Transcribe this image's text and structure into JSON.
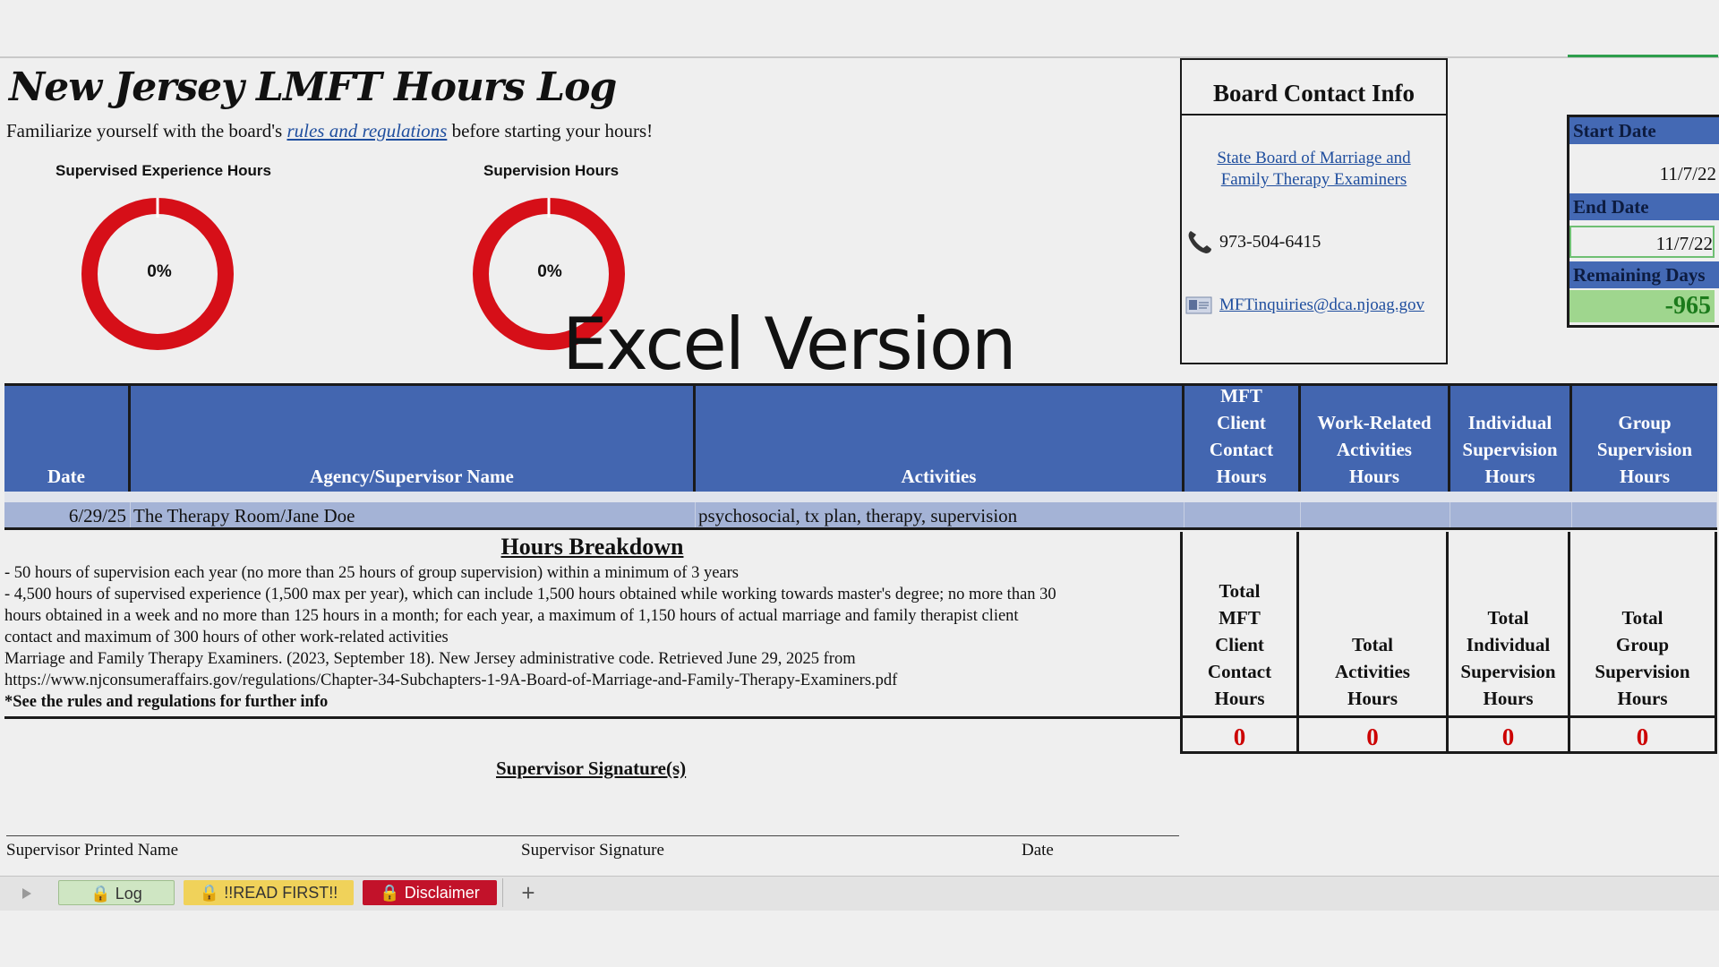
{
  "title": "New Jersey LMFT Hours Log",
  "subtitle": {
    "before": "Familiarize yourself with the board's ",
    "link": "rules and regulations",
    "after": " before starting your hours!"
  },
  "gauges": [
    {
      "label": "Supervised Experience Hours",
      "percent_text": "0%",
      "progress": 0
    },
    {
      "label": "Supervision Hours",
      "percent_text": "0%",
      "progress": 0
    }
  ],
  "watermark": "Excel Version",
  "contact": {
    "heading": "Board Contact Info",
    "board_link_line1": "State Board of Marriage and",
    "board_link_line2": "Family Therapy Examiners",
    "phone": "973-504-6415",
    "email": "MFTinquiries@dca.njoag.gov",
    "phone_icon": "phone-icon",
    "email_icon": "email-icon"
  },
  "dates": {
    "start_label": "Start Date",
    "start_value": "11/7/22",
    "end_label": "End Date",
    "end_value": "11/7/22",
    "remaining_label": "Remaining Days",
    "remaining_value": "-965"
  },
  "table": {
    "headers": {
      "date": "Date",
      "agency": "Agency/Supervisor Name",
      "activities": "Activities",
      "mft": [
        "MFT",
        "Client",
        "Contact",
        "Hours"
      ],
      "work": [
        "Work-Related",
        "Activities",
        "Hours"
      ],
      "indiv": [
        "Individual",
        "Supervision",
        "Hours"
      ],
      "group": [
        "Group",
        "Supervision",
        "Hours"
      ]
    },
    "row": {
      "date": "6/29/25",
      "agency": "The Therapy Room/Jane Doe",
      "activities": "psychosocial, tx plan, therapy, supervision"
    }
  },
  "breakdown": {
    "title": "Hours Breakdown",
    "lines": [
      "- 50 hours of supervision each year (no more than 25 hours of group supervision) within a minimum of 3 years",
      "- 4,500 hours of supervised experience (1,500 max per year), which can include 1,500 hours obtained while working towards master's degree; no more than 30",
      "hours obtained in a week and no more than 125 hours in a month; for each year, a maximum of 1,150 hours of actual marriage and family therapist client",
      "contact and maximum of 300 hours of other work-related activities",
      "Marriage and Family Therapy Examiners. (2023, September 18). New Jersey administrative code. Retrieved June 29, 2025 from",
      "https://www.njconsumeraffairs.gov/regulations/Chapter-34-Subchapters-1-9A-Board-of-Marriage-and-Family-Therapy-Examiners.pdf"
    ],
    "note": "*See the rules and regulations for further info"
  },
  "totals": {
    "mft": [
      "Total",
      "MFT",
      "Client",
      "Contact",
      "Hours"
    ],
    "activities": [
      "Total",
      "Activities",
      "Hours"
    ],
    "indiv": [
      "Total",
      "Individual",
      "Supervision",
      "Hours"
    ],
    "group": [
      "Total",
      "Group",
      "Supervision",
      "Hours"
    ],
    "values": [
      "0",
      "0",
      "0",
      "0"
    ]
  },
  "signature": {
    "title": "Supervisor Signature(s)",
    "printed_name": "Supervisor Printed Name",
    "signature": "Supervisor Signature",
    "date": "Date"
  },
  "tabs": [
    {
      "label": "Log",
      "icon": "lock-icon",
      "bg": "#cfe6c3",
      "fg": "#333333"
    },
    {
      "label": "!!READ FIRST!!",
      "icon": "lock-icon",
      "bg": "#f0d25a",
      "fg": "#333333"
    },
    {
      "label": "Disclaimer",
      "icon": "lock-icon",
      "bg": "#c2122a",
      "fg": "#ffffff"
    }
  ],
  "add_sheet": "+",
  "colors": {
    "header_blue": "#4366b0",
    "gauge_red": "#d60f18",
    "total_red": "#cc0000",
    "remaining_green": "#9fd68e"
  }
}
